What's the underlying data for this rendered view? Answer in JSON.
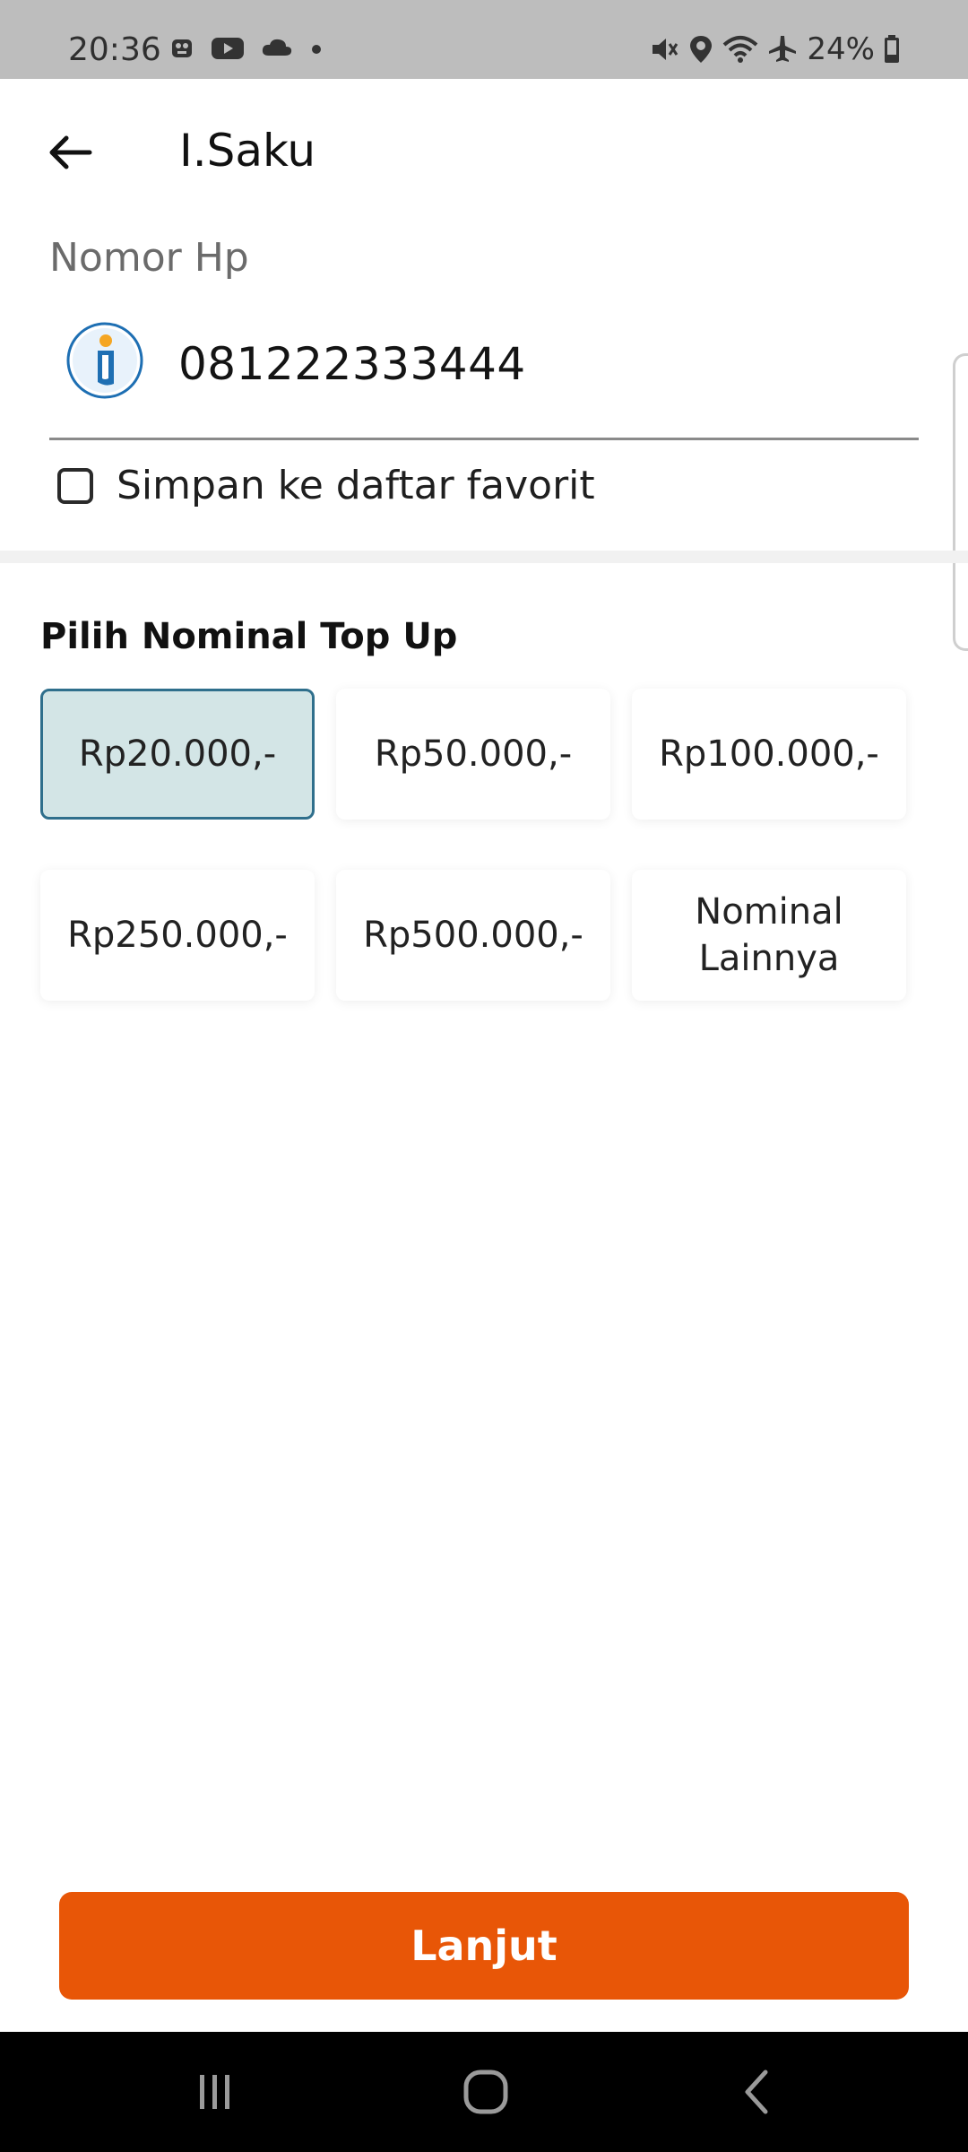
{
  "status_bar": {
    "time": "20:36",
    "battery": "24%"
  },
  "app_bar": {
    "title": "I.Saku"
  },
  "phone": {
    "label": "Nomor Hp",
    "value": "081222333444"
  },
  "favorite": {
    "label": "Simpan ke daftar favorit",
    "checked": false
  },
  "nominal": {
    "title": "Pilih Nominal Top Up",
    "selected_index": 0,
    "options": [
      {
        "label": "Rp20.000,-"
      },
      {
        "label": "Rp50.000,-"
      },
      {
        "label": "Rp100.000,-"
      },
      {
        "label": "Rp250.000,-"
      },
      {
        "label": "Rp500.000,-"
      },
      {
        "label": "Nominal\nLainnya"
      }
    ]
  },
  "action": {
    "label": "Lanjut"
  },
  "colors": {
    "accent": "#e85607",
    "selected_bg": "#d3e5e6",
    "selected_border": "#2f6f8c"
  },
  "icons": {
    "back": "arrow-left-icon",
    "operator": "isaku-logo-icon",
    "nav_recent": "recent-apps-icon",
    "nav_home": "home-icon",
    "nav_back": "chevron-left-icon"
  }
}
